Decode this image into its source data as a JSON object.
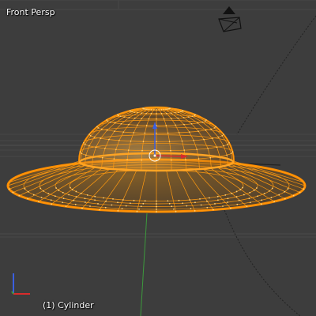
{
  "viewport": {
    "view_name": "Front Persp",
    "object_frame": "(1)",
    "object_name": "Cylinder",
    "object_info": "(1) Cylinder"
  },
  "colors": {
    "background": "#3d3d3d",
    "grid": "#474747",
    "horizon": "#555555",
    "mesh_wire": "#ff8c00",
    "mesh_fill": "#c87a15",
    "mesh_highlight": "#ffc24d",
    "x_axis": "#d92b2b",
    "y_axis": "#3d9a3d",
    "z_axis": "#3a5fe0",
    "camera": "#1a1a1a"
  },
  "icons": {
    "camera": "camera-icon",
    "axes": "axes-gizmo-icon",
    "cursor": "3d-cursor-icon",
    "manipulator": "transform-manipulator-icon"
  }
}
